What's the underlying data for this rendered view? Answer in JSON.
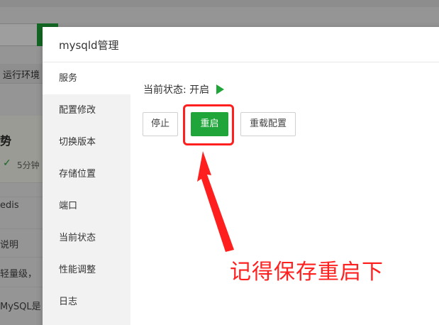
{
  "background": {
    "tab_label": "运行环境",
    "card_title": "势",
    "time_text": "5分钟",
    "list_items": [
      "edis",
      "说明",
      "轻量级，",
      "MySQL是"
    ]
  },
  "modal": {
    "title": "mysqld管理",
    "sidebar": [
      {
        "label": "服务",
        "active": true
      },
      {
        "label": "配置修改",
        "active": false
      },
      {
        "label": "切换版本",
        "active": false
      },
      {
        "label": "存储位置",
        "active": false
      },
      {
        "label": "端口",
        "active": false
      },
      {
        "label": "当前状态",
        "active": false
      },
      {
        "label": "性能调整",
        "active": false
      },
      {
        "label": "日志",
        "active": false
      }
    ],
    "status_label": "当前状态:",
    "status_value": "开启",
    "buttons": {
      "stop": "停止",
      "restart": "重启",
      "reload": "重载配置"
    }
  },
  "annotation": {
    "text": "记得保存重启下",
    "color": "#ff2020"
  },
  "colors": {
    "accent": "#20a53a",
    "highlight": "#ff1f1f"
  },
  "icons": [
    "play-icon",
    "check-icon",
    "arrow-icon"
  ]
}
